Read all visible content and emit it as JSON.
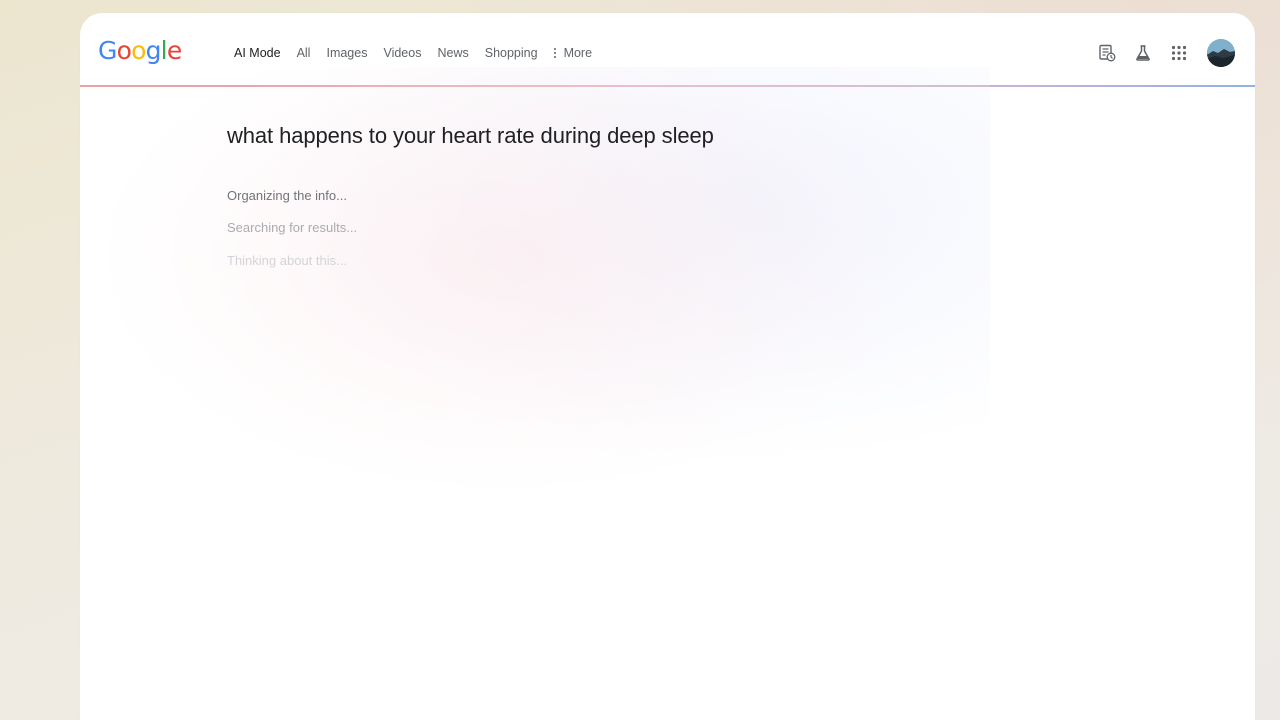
{
  "logo": {
    "letters": [
      "G",
      "o",
      "o",
      "g",
      "l",
      "e"
    ]
  },
  "nav": {
    "tabs": [
      {
        "label": "AI Mode",
        "active": true
      },
      {
        "label": "All"
      },
      {
        "label": "Images"
      },
      {
        "label": "Videos"
      },
      {
        "label": "News"
      },
      {
        "label": "Shopping"
      }
    ],
    "more_label": "More"
  },
  "header_icons": [
    "search-history-icon",
    "labs-flask-icon",
    "apps-grid-icon",
    "account-avatar"
  ],
  "query": "what happens to your heart rate during deep sleep",
  "status": [
    "Organizing the info...",
    "Searching for results...",
    "Thinking about this..."
  ],
  "colors": {
    "google_blue": "#4285f4",
    "google_red": "#ea4335",
    "google_yellow": "#fbbc05",
    "google_green": "#34a853",
    "text_primary": "#202124",
    "text_secondary": "#5f6368"
  }
}
